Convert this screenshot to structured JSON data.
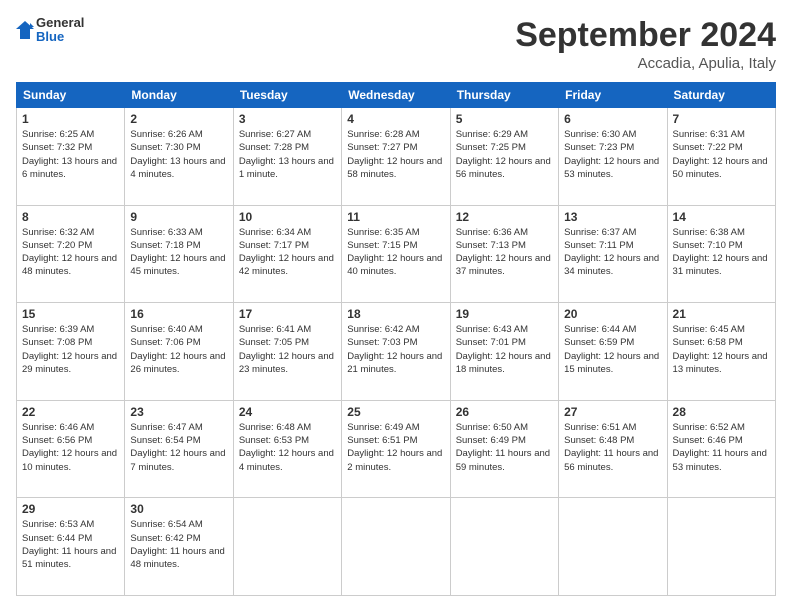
{
  "header": {
    "logo_general": "General",
    "logo_blue": "Blue",
    "month_title": "September 2024",
    "subtitle": "Accadia, Apulia, Italy"
  },
  "columns": [
    "Sunday",
    "Monday",
    "Tuesday",
    "Wednesday",
    "Thursday",
    "Friday",
    "Saturday"
  ],
  "weeks": [
    [
      {
        "day": "1",
        "sunrise": "Sunrise: 6:25 AM",
        "sunset": "Sunset: 7:32 PM",
        "daylight": "Daylight: 13 hours and 6 minutes."
      },
      {
        "day": "2",
        "sunrise": "Sunrise: 6:26 AM",
        "sunset": "Sunset: 7:30 PM",
        "daylight": "Daylight: 13 hours and 4 minutes."
      },
      {
        "day": "3",
        "sunrise": "Sunrise: 6:27 AM",
        "sunset": "Sunset: 7:28 PM",
        "daylight": "Daylight: 13 hours and 1 minute."
      },
      {
        "day": "4",
        "sunrise": "Sunrise: 6:28 AM",
        "sunset": "Sunset: 7:27 PM",
        "daylight": "Daylight: 12 hours and 58 minutes."
      },
      {
        "day": "5",
        "sunrise": "Sunrise: 6:29 AM",
        "sunset": "Sunset: 7:25 PM",
        "daylight": "Daylight: 12 hours and 56 minutes."
      },
      {
        "day": "6",
        "sunrise": "Sunrise: 6:30 AM",
        "sunset": "Sunset: 7:23 PM",
        "daylight": "Daylight: 12 hours and 53 minutes."
      },
      {
        "day": "7",
        "sunrise": "Sunrise: 6:31 AM",
        "sunset": "Sunset: 7:22 PM",
        "daylight": "Daylight: 12 hours and 50 minutes."
      }
    ],
    [
      {
        "day": "8",
        "sunrise": "Sunrise: 6:32 AM",
        "sunset": "Sunset: 7:20 PM",
        "daylight": "Daylight: 12 hours and 48 minutes."
      },
      {
        "day": "9",
        "sunrise": "Sunrise: 6:33 AM",
        "sunset": "Sunset: 7:18 PM",
        "daylight": "Daylight: 12 hours and 45 minutes."
      },
      {
        "day": "10",
        "sunrise": "Sunrise: 6:34 AM",
        "sunset": "Sunset: 7:17 PM",
        "daylight": "Daylight: 12 hours and 42 minutes."
      },
      {
        "day": "11",
        "sunrise": "Sunrise: 6:35 AM",
        "sunset": "Sunset: 7:15 PM",
        "daylight": "Daylight: 12 hours and 40 minutes."
      },
      {
        "day": "12",
        "sunrise": "Sunrise: 6:36 AM",
        "sunset": "Sunset: 7:13 PM",
        "daylight": "Daylight: 12 hours and 37 minutes."
      },
      {
        "day": "13",
        "sunrise": "Sunrise: 6:37 AM",
        "sunset": "Sunset: 7:11 PM",
        "daylight": "Daylight: 12 hours and 34 minutes."
      },
      {
        "day": "14",
        "sunrise": "Sunrise: 6:38 AM",
        "sunset": "Sunset: 7:10 PM",
        "daylight": "Daylight: 12 hours and 31 minutes."
      }
    ],
    [
      {
        "day": "15",
        "sunrise": "Sunrise: 6:39 AM",
        "sunset": "Sunset: 7:08 PM",
        "daylight": "Daylight: 12 hours and 29 minutes."
      },
      {
        "day": "16",
        "sunrise": "Sunrise: 6:40 AM",
        "sunset": "Sunset: 7:06 PM",
        "daylight": "Daylight: 12 hours and 26 minutes."
      },
      {
        "day": "17",
        "sunrise": "Sunrise: 6:41 AM",
        "sunset": "Sunset: 7:05 PM",
        "daylight": "Daylight: 12 hours and 23 minutes."
      },
      {
        "day": "18",
        "sunrise": "Sunrise: 6:42 AM",
        "sunset": "Sunset: 7:03 PM",
        "daylight": "Daylight: 12 hours and 21 minutes."
      },
      {
        "day": "19",
        "sunrise": "Sunrise: 6:43 AM",
        "sunset": "Sunset: 7:01 PM",
        "daylight": "Daylight: 12 hours and 18 minutes."
      },
      {
        "day": "20",
        "sunrise": "Sunrise: 6:44 AM",
        "sunset": "Sunset: 6:59 PM",
        "daylight": "Daylight: 12 hours and 15 minutes."
      },
      {
        "day": "21",
        "sunrise": "Sunrise: 6:45 AM",
        "sunset": "Sunset: 6:58 PM",
        "daylight": "Daylight: 12 hours and 13 minutes."
      }
    ],
    [
      {
        "day": "22",
        "sunrise": "Sunrise: 6:46 AM",
        "sunset": "Sunset: 6:56 PM",
        "daylight": "Daylight: 12 hours and 10 minutes."
      },
      {
        "day": "23",
        "sunrise": "Sunrise: 6:47 AM",
        "sunset": "Sunset: 6:54 PM",
        "daylight": "Daylight: 12 hours and 7 minutes."
      },
      {
        "day": "24",
        "sunrise": "Sunrise: 6:48 AM",
        "sunset": "Sunset: 6:53 PM",
        "daylight": "Daylight: 12 hours and 4 minutes."
      },
      {
        "day": "25",
        "sunrise": "Sunrise: 6:49 AM",
        "sunset": "Sunset: 6:51 PM",
        "daylight": "Daylight: 12 hours and 2 minutes."
      },
      {
        "day": "26",
        "sunrise": "Sunrise: 6:50 AM",
        "sunset": "Sunset: 6:49 PM",
        "daylight": "Daylight: 11 hours and 59 minutes."
      },
      {
        "day": "27",
        "sunrise": "Sunrise: 6:51 AM",
        "sunset": "Sunset: 6:48 PM",
        "daylight": "Daylight: 11 hours and 56 minutes."
      },
      {
        "day": "28",
        "sunrise": "Sunrise: 6:52 AM",
        "sunset": "Sunset: 6:46 PM",
        "daylight": "Daylight: 11 hours and 53 minutes."
      }
    ],
    [
      {
        "day": "29",
        "sunrise": "Sunrise: 6:53 AM",
        "sunset": "Sunset: 6:44 PM",
        "daylight": "Daylight: 11 hours and 51 minutes."
      },
      {
        "day": "30",
        "sunrise": "Sunrise: 6:54 AM",
        "sunset": "Sunset: 6:42 PM",
        "daylight": "Daylight: 11 hours and 48 minutes."
      },
      null,
      null,
      null,
      null,
      null
    ]
  ]
}
